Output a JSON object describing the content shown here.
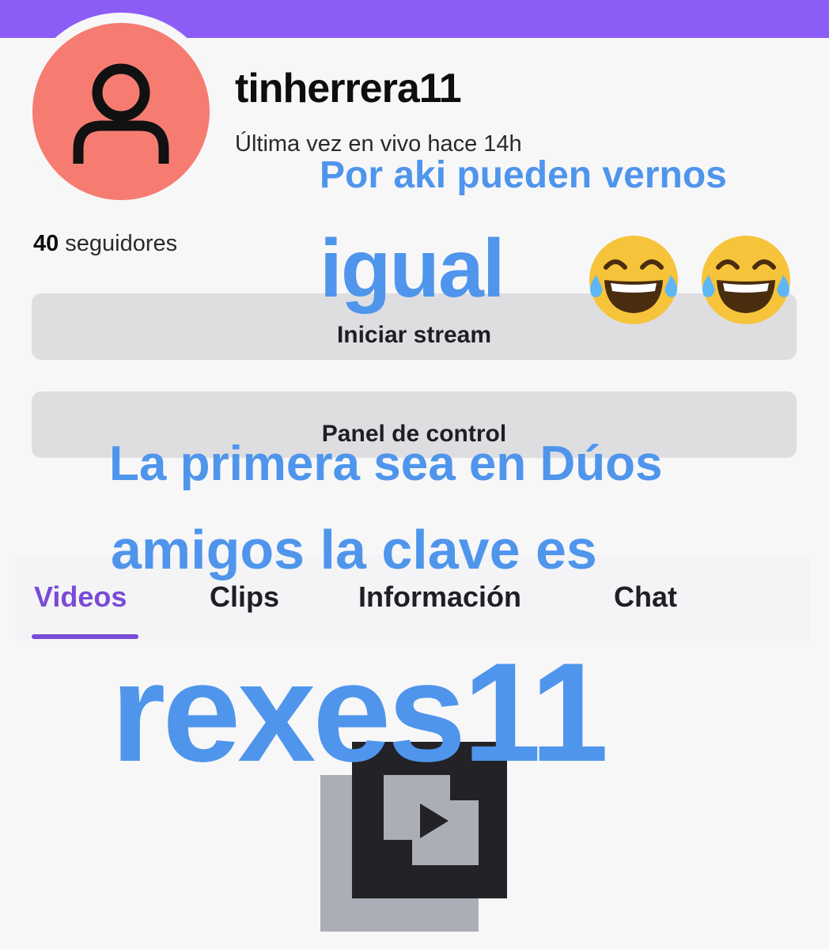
{
  "profile": {
    "username": "tinherrera11",
    "last_live": "Última vez en vivo hace 14h",
    "followers_count": "40",
    "followers_label": "seguidores",
    "avatar_icon": "user-silhouette-icon",
    "avatar_color": "#f67c72"
  },
  "buttons": {
    "start_stream": "Iniciar stream",
    "control_panel": "Panel de control"
  },
  "tabs": [
    {
      "label": "Videos",
      "active": true
    },
    {
      "label": "Clips",
      "active": false
    },
    {
      "label": "Información",
      "active": false
    },
    {
      "label": "Chat",
      "active": false
    }
  ],
  "empty_state": {
    "icon": "film-play-icon"
  },
  "story_overlay": {
    "line1": "Por aki pueden vernos",
    "line2": "igual",
    "emoji": "😂😂",
    "line3": "La primera sea en Dúos",
    "line4": "amigos la clave es",
    "line5": "rexes11"
  },
  "colors": {
    "brand_purple": "#8c5cf6",
    "active_tab": "#7a4bd6",
    "overlay_text": "#4f95ec"
  }
}
